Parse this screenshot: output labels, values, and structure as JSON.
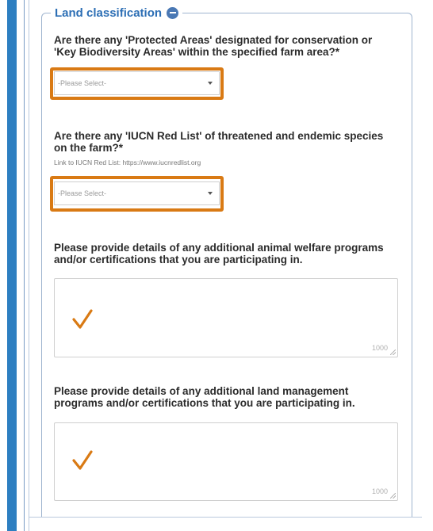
{
  "section": {
    "legend": "Land classification",
    "collapse_icon": "minus-circle-icon"
  },
  "questions": {
    "protected_areas": {
      "label_line1": "Are there any 'Protected Areas' designated for conservation or",
      "label_line2": "'Key Biodiversity Areas' within the specified farm area?*",
      "select_value": "-Please Select-"
    },
    "iucn_red_list": {
      "label_line1": "Are there any 'IUCN Red List' of threatened and endemic species",
      "label_line2": "on the farm?*",
      "helper": "Link to IUCN Red List: https://www.iucnredlist.org",
      "select_value": "-Please Select-"
    },
    "animal_welfare": {
      "label_line1": "Please provide details of any additional animal welfare programs",
      "label_line2": "and/or certifications that you are participating in.",
      "char_limit": "1000"
    },
    "land_management": {
      "label_line1": "Please provide details of any additional land management",
      "label_line2": "programs and/or certifications that you are participating in.",
      "char_limit": "1000"
    }
  },
  "colors": {
    "highlight": "#d97a14",
    "accent": "#2d7fc1",
    "legend_text": "#2d6fb5"
  }
}
